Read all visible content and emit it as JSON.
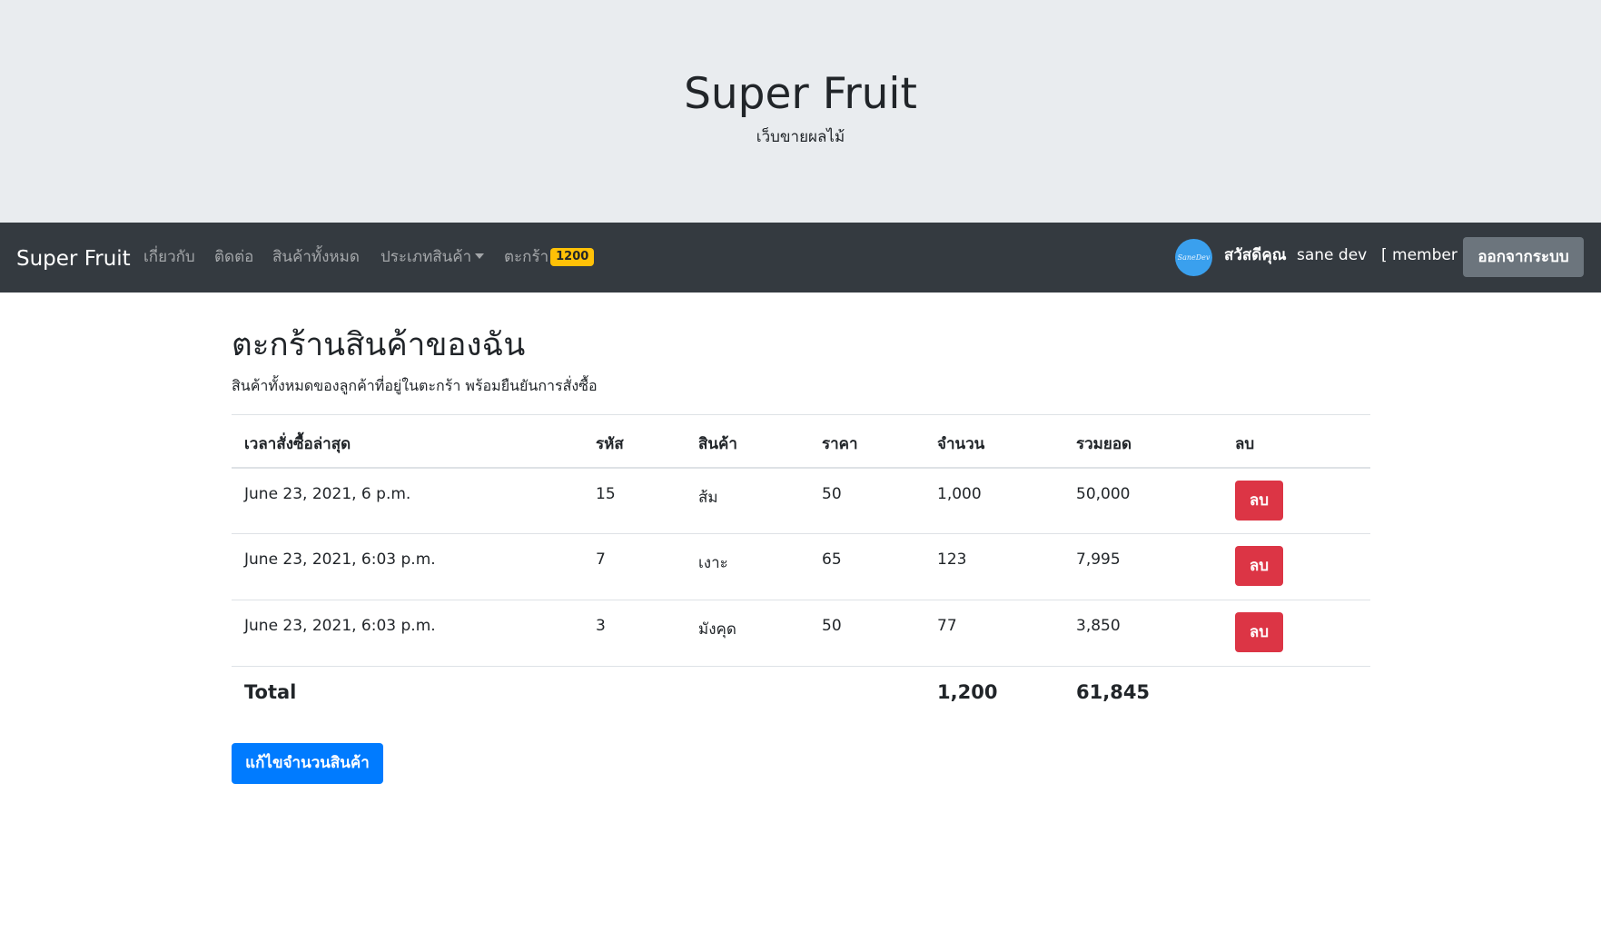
{
  "header": {
    "title": "Super Fruit",
    "subtitle": "เว็บขายผลไม้"
  },
  "navbar": {
    "brand": "Super Fruit",
    "links": {
      "about": "เกี่ยวกับ",
      "contact": "ติดต่อ",
      "all_products": "สินค้าทั้งหมด",
      "categories": "ประเภทสินค้า",
      "cart": "ตะกร้า"
    },
    "cart_badge": "1200",
    "avatar_text": "SaneDev",
    "greeting": "สวัสดีคุณ",
    "username": "sane dev",
    "role": "[ member ]",
    "logout_label": "ออกจากระบบ"
  },
  "main": {
    "heading": "ตะกร้านสินค้าของฉัน",
    "description": "สินค้าทั้งหมดของลูกค้าที่อยู่ในตะกร้า พร้อมยืนยันการสั่งซื้อ",
    "table": {
      "headers": {
        "time": "เวลาสั่งซื้อล่าสุด",
        "code": "รหัส",
        "product": "สินค้า",
        "price": "ราคา",
        "quantity": "จำนวน",
        "total": "รวมยอด",
        "delete": "ลบ"
      },
      "rows": [
        {
          "time": "June 23, 2021, 6 p.m.",
          "code": "15",
          "product": "ส้ม",
          "price": "50",
          "quantity": "1,000",
          "total": "50,000",
          "delete_label": "ลบ"
        },
        {
          "time": "June 23, 2021, 6:03 p.m.",
          "code": "7",
          "product": "เงาะ",
          "price": "65",
          "quantity": "123",
          "total": "7,995",
          "delete_label": "ลบ"
        },
        {
          "time": "June 23, 2021, 6:03 p.m.",
          "code": "3",
          "product": "มังคุด",
          "price": "50",
          "quantity": "77",
          "total": "3,850",
          "delete_label": "ลบ"
        }
      ],
      "footer": {
        "label": "Total",
        "quantity": "1,200",
        "total": "61,845"
      }
    },
    "edit_button": "แก้ไขจำนวนสินค้า"
  },
  "colors": {
    "jumbotron_bg": "#e9ecef",
    "navbar_bg": "#343a40",
    "badge": "#ffc107",
    "danger": "#dc3545",
    "primary": "#007bff",
    "secondary": "#6c757d"
  }
}
